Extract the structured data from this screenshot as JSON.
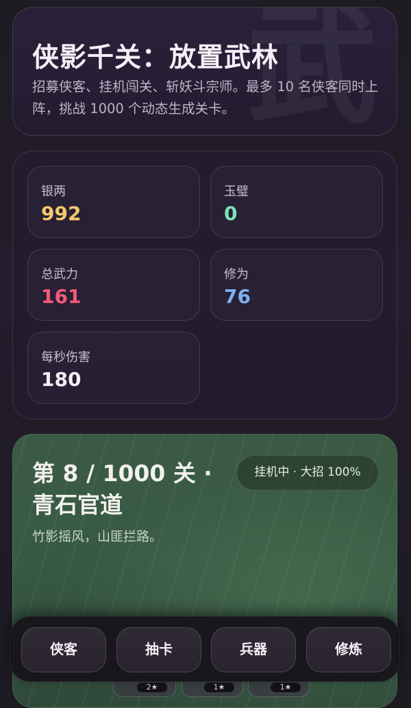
{
  "header": {
    "watermark": "武",
    "title": "侠影千关：放置武林",
    "subtitle": "招募侠客、挂机闯关、斩妖斗宗师。最多 10 名侠客同时上阵，挑战 1000 个动态生成关卡。"
  },
  "stats": [
    {
      "label": "银两",
      "value": "992",
      "color": "#f5c86e"
    },
    {
      "label": "玉璧",
      "value": "0",
      "color": "#7fe3b9"
    },
    {
      "label": "总武力",
      "value": "161",
      "color": "#f25a7a"
    },
    {
      "label": "修为",
      "value": "76",
      "color": "#7fb0f0"
    },
    {
      "label": "每秒伤害",
      "value": "180",
      "color": "#f4f0f6"
    }
  ],
  "stage": {
    "title": "第 8 / 1000 关 · 青石官道",
    "description": "竹影摇风，山匪拦路。",
    "status": "挂机中 · 大招 100%"
  },
  "nav": {
    "items": [
      {
        "label": "侠客"
      },
      {
        "label": "抽卡"
      },
      {
        "label": "兵器"
      },
      {
        "label": "修炼"
      }
    ]
  },
  "peek_badges": [
    "2★",
    "1★",
    "1★"
  ]
}
